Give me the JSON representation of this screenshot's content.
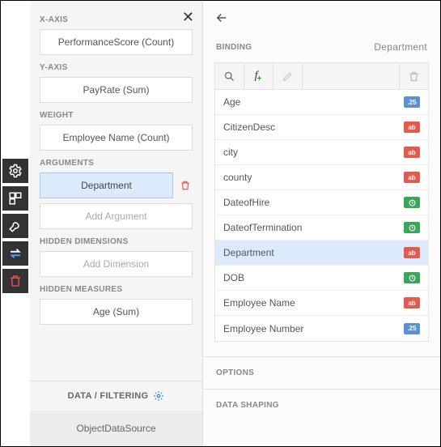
{
  "rail": {
    "items": [
      "gear",
      "layout",
      "wrench",
      "swap",
      "trash"
    ]
  },
  "left": {
    "sections": {
      "xaxis": {
        "label": "X-AXIS",
        "value": "PerformanceScore (Count)"
      },
      "yaxis": {
        "label": "Y-AXIS",
        "value": "PayRate (Sum)"
      },
      "weight": {
        "label": "WEIGHT",
        "value": "Employee Name (Count)"
      },
      "arguments": {
        "label": "ARGUMENTS",
        "value": "Department",
        "add": "Add Argument"
      },
      "hiddenDims": {
        "label": "HIDDEN DIMENSIONS",
        "add": "Add Dimension"
      },
      "hiddenMeas": {
        "label": "HIDDEN MEASURES",
        "value": "Age (Sum)"
      }
    },
    "footer": {
      "filter": "DATA / FILTERING",
      "source": "ObjectDataSource"
    }
  },
  "right": {
    "title": "BINDING",
    "current": "Department",
    "fields": [
      {
        "name": "Age",
        "type": "num"
      },
      {
        "name": "CitizenDesc",
        "type": "txt"
      },
      {
        "name": "city",
        "type": "txt"
      },
      {
        "name": "county",
        "type": "txt"
      },
      {
        "name": "DateofHire",
        "type": "date"
      },
      {
        "name": "DateofTermination",
        "type": "date"
      },
      {
        "name": "Department",
        "type": "txt",
        "selected": true
      },
      {
        "name": "DOB",
        "type": "date"
      },
      {
        "name": "Employee Name",
        "type": "txt"
      },
      {
        "name": "Employee Number",
        "type": "num"
      }
    ],
    "badges": {
      "num": ".25",
      "txt": "ab"
    },
    "accordion": [
      "OPTIONS",
      "DATA SHAPING"
    ]
  }
}
